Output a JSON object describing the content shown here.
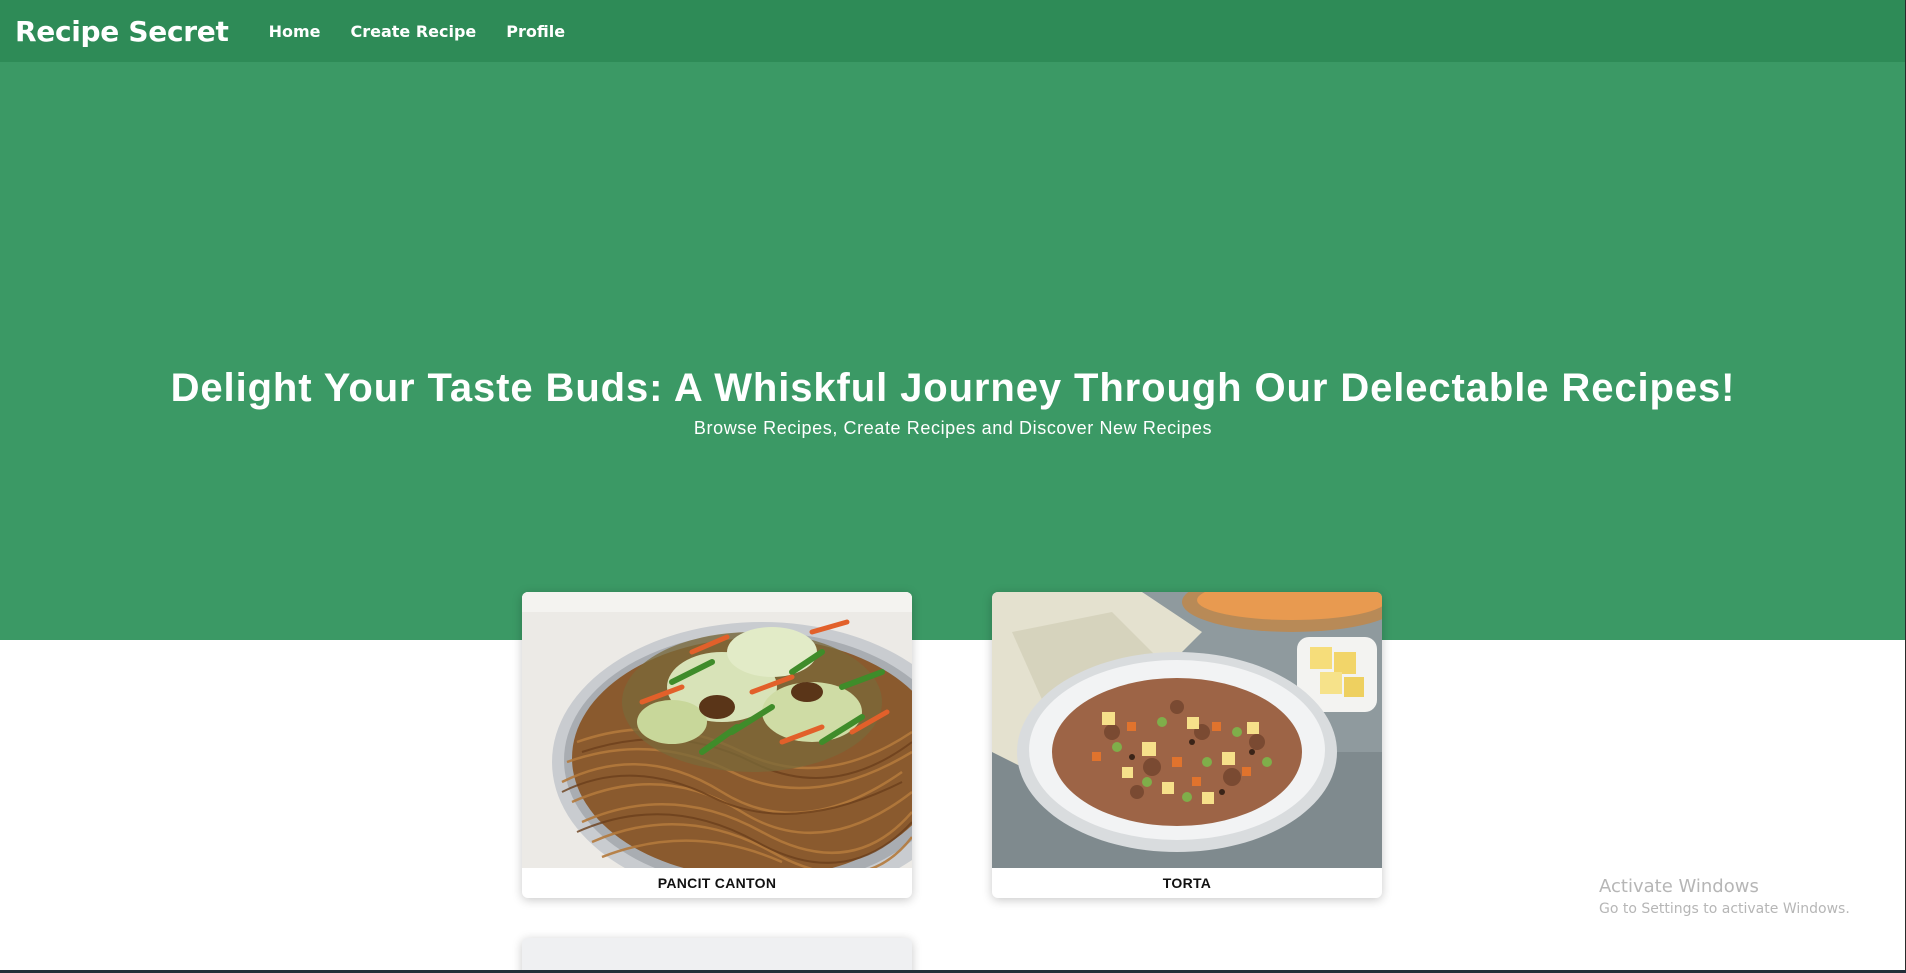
{
  "navbar": {
    "brand": "Recipe Secret",
    "links": [
      "Home",
      "Create Recipe",
      "Profile"
    ],
    "background": "#2e8b57"
  },
  "hero": {
    "title": "Delight Your Taste Buds: A Whiskful Journey Through Our Delectable Recipes!",
    "subtitle": "Browse Recipes, Create Recipes and Discover New Recipes",
    "background": "#3b9965"
  },
  "recipes": [
    {
      "title": "PANCIT CANTON",
      "image": "stir-fried-noodles-with-vegetables"
    },
    {
      "title": "TORTA",
      "image": "ground-meat-rice-bowl"
    },
    {
      "title": "",
      "image": "partially-visible-card"
    }
  ],
  "watermark": {
    "title": "Activate Windows",
    "subtitle": "Go to Settings to activate Windows."
  }
}
